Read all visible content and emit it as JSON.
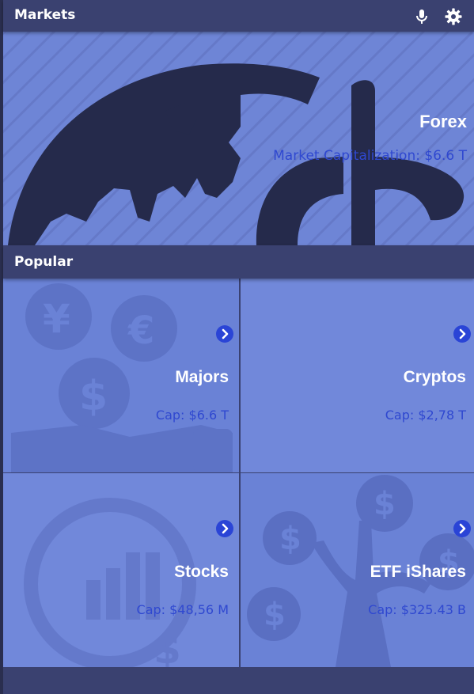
{
  "header": {
    "title": "Markets",
    "mic_icon": "microphone-icon",
    "settings_icon": "gear-icon"
  },
  "hero": {
    "title": "Forex",
    "capitalization": "Market Capitalization: $6.6 T"
  },
  "section": {
    "title": "Popular"
  },
  "tiles": [
    {
      "title": "Majors",
      "cap": "Cap: $6.6 T",
      "arrow_icon": "chevron-right-circle-icon"
    },
    {
      "title": "Cryptos",
      "cap": "Cap: $2,78 T",
      "arrow_icon": "chevron-right-circle-icon"
    },
    {
      "title": "Stocks",
      "cap": "Cap: $48,56 M",
      "arrow_icon": "chevron-right-circle-icon"
    },
    {
      "title": "ETF iShares",
      "cap": "Cap: $325.43 B",
      "arrow_icon": "chevron-right-circle-icon"
    }
  ],
  "colors": {
    "header_bg": "#3a4170",
    "hero_bg": "#6e85d6",
    "tile_bg_1": "#6a82d6",
    "tile_bg_2": "#7188da",
    "illustration": "#252a4b",
    "cap_text": "#2f48d0",
    "accent": "#2a44d6"
  }
}
